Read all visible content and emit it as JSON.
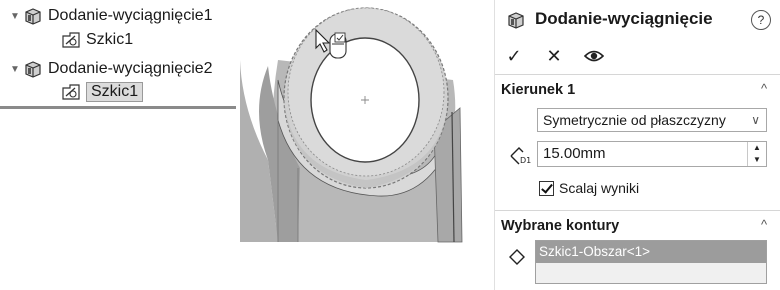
{
  "tree": {
    "items": [
      {
        "label": "Dodanie-wyciągnięcie1",
        "icon": "extrude-feature-icon",
        "expanded": true
      },
      {
        "label": "Szkic1",
        "icon": "sketch-icon"
      },
      {
        "label": "Dodanie-wyciągnięcie2",
        "icon": "extrude-feature-icon",
        "expanded": true
      },
      {
        "label": "Szkic1",
        "icon": "sketch-icon",
        "selected": true
      }
    ]
  },
  "property_manager": {
    "title": "Dodanie-wyciągnięcie",
    "help": "?",
    "actions": {
      "ok": "✓",
      "cancel": "✕",
      "preview": "eye-icon"
    },
    "direction": {
      "title": "Kierunek 1",
      "end_condition": "Symetrycznie od płaszczyzny",
      "depth": "15.00mm",
      "merge_label": "Scalaj wyniki",
      "merge_checked": true
    },
    "contours": {
      "title": "Wybrane kontury",
      "items": [
        "Szkic1-Obszar<1>"
      ]
    }
  },
  "colors": {
    "selection_gray": "#9c9c9c",
    "model_gray": "#b9b9b9",
    "highlight_gray": "#d8d8d8"
  }
}
